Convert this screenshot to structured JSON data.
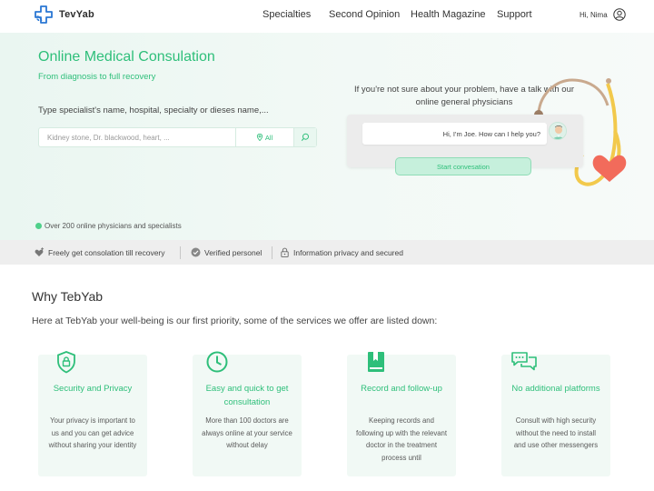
{
  "header": {
    "brand": "TevYab",
    "nav": [
      "Specialties",
      "Second Opinion",
      "Health Magazine",
      "Support"
    ],
    "user_greeting": "Hi, Nima"
  },
  "hero": {
    "title": "Online Medical Consulation",
    "subtitle": "From diagnosis to full recovery",
    "search_label": "Type specialist's name, hospital, specialty or dieses name,...",
    "search_placeholder": "Kidney stone, Dr. blackwood, heart, ...",
    "filter_label": "All",
    "chat_intro": "If you're not sure about your problem, have a talk with our online general physicians",
    "chat_message": "Hi, I'm Joe. How can I help you?",
    "start_button": "Start convesation",
    "online_text": "Over 200 online physicians and specialists"
  },
  "features": [
    {
      "label": "Freely get consolation till recovery",
      "icon": "heart-plus-icon"
    },
    {
      "label": "Verified personel",
      "icon": "verified-badge-icon"
    },
    {
      "label": "Information privacy and secured",
      "icon": "lock-icon"
    }
  ],
  "why": {
    "title": "Why TebYab",
    "subtitle": "Here at TebYab your well-being is our first priority, some of the services we offer are listed down:",
    "cards": [
      {
        "icon": "shield-lock-icon",
        "title": "Security and Privacy",
        "desc": "Your privacy is important to us and you can get advice without sharing your identity"
      },
      {
        "icon": "clock-icon",
        "title": "Easy and quick to get consultation",
        "desc": "More than 100 doctors are always online at your service without delay"
      },
      {
        "icon": "bookmark-book-icon",
        "title": "Record and follow-up",
        "desc": "Keeping records and following up with the relevant doctor in the treatment process until"
      },
      {
        "icon": "chat-bubbles-icon",
        "title": "No additional platforms",
        "desc": "Consult with high security without the need to install and use other messengers"
      }
    ]
  },
  "colors": {
    "accent": "#2ebf7a",
    "hero_background": "#eaf6f1",
    "features_bar": "#eeeeee",
    "card_background": "#f1f9f5"
  }
}
